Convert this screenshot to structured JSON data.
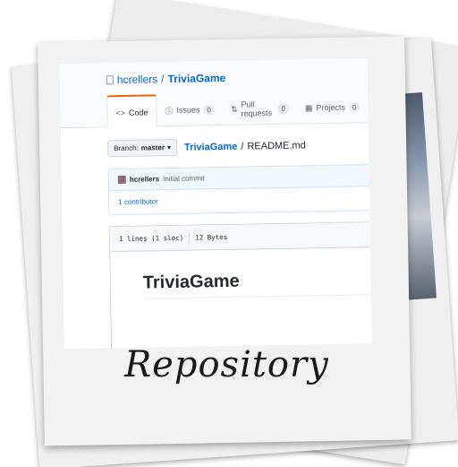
{
  "repo": {
    "owner": "hcrellers",
    "separator": "/",
    "name": "TriviaGame"
  },
  "tabs": [
    {
      "label": "Code",
      "icon": "code-icon"
    },
    {
      "label": "Issues",
      "icon": "issue-icon",
      "count": "0"
    },
    {
      "label": "Pull requests",
      "icon": "pull-request-icon",
      "count": "0"
    },
    {
      "label": "Projects",
      "icon": "project-icon",
      "count": "0"
    }
  ],
  "branch": {
    "label": "Branch:",
    "value": "master"
  },
  "breadcrumb": {
    "repo": "TriviaGame",
    "separator": "/",
    "file": "README.md"
  },
  "commit": {
    "author": "hcrellers",
    "message": "Initial commit",
    "contributors": "1 contributor"
  },
  "file": {
    "lines": "1 lines (1 sloc)",
    "size": "12 Bytes"
  },
  "readme": {
    "heading": "TriviaGame"
  },
  "caption": "Repository",
  "colors": {
    "link": "#0366d6",
    "tab_accent": "#e36209",
    "text": "#24292e"
  }
}
